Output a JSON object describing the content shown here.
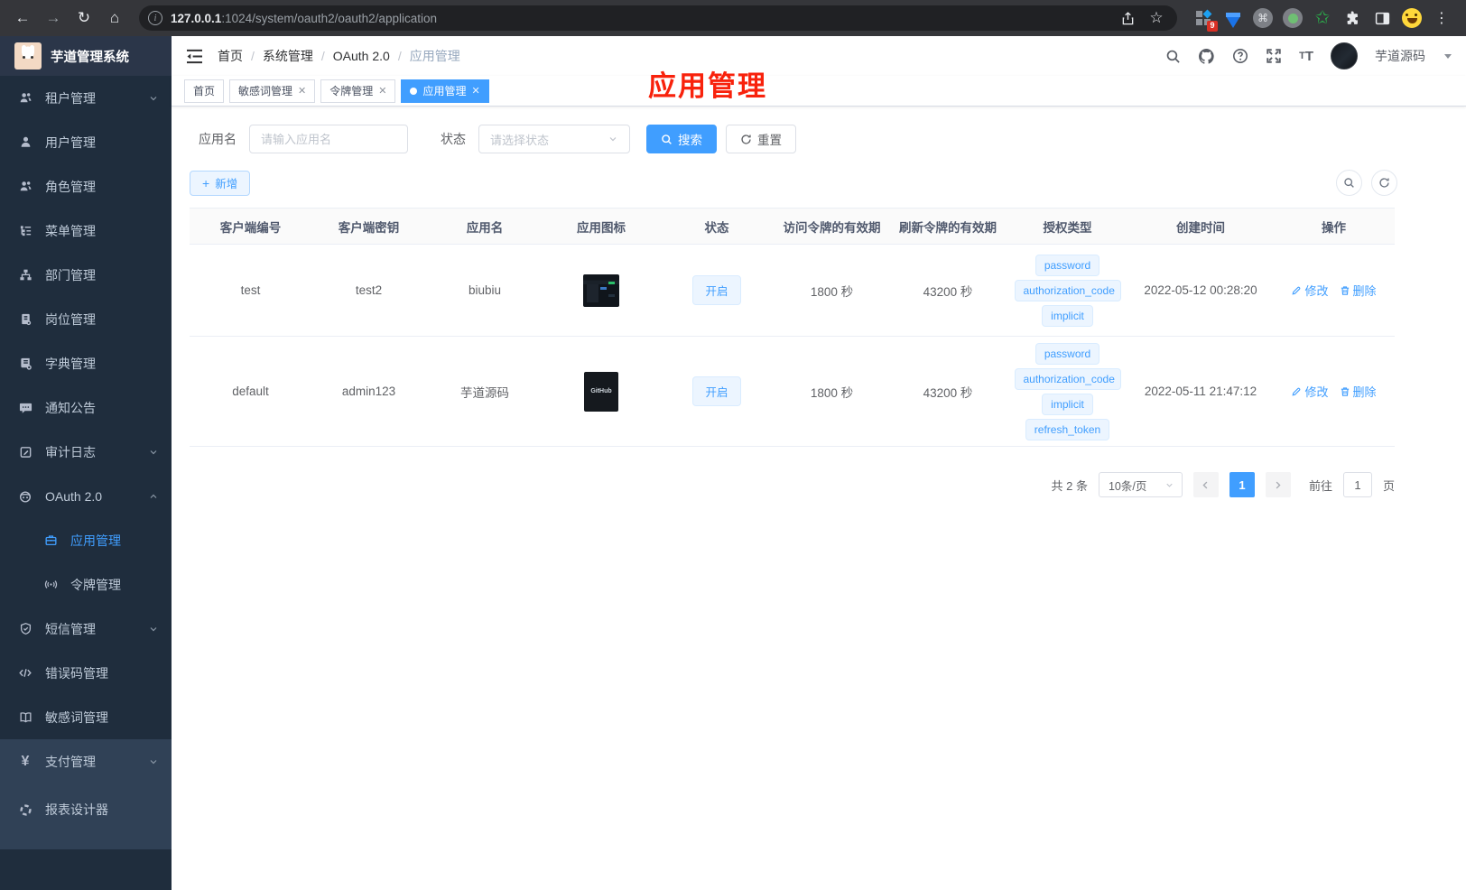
{
  "browser": {
    "url_host": "127.0.0.1",
    "url_path": ":1024/system/oauth2/oauth2/application",
    "extension_badge": "9"
  },
  "sidebar": {
    "title": "芋道管理系统",
    "items": [
      {
        "label": "租户管理",
        "icon": "tenants-icon"
      },
      {
        "label": "用户管理",
        "icon": "user-icon"
      },
      {
        "label": "角色管理",
        "icon": "roles-icon"
      },
      {
        "label": "菜单管理",
        "icon": "menu-tree-icon"
      },
      {
        "label": "部门管理",
        "icon": "dept-icon"
      },
      {
        "label": "岗位管理",
        "icon": "post-icon"
      },
      {
        "label": "字典管理",
        "icon": "dict-icon"
      },
      {
        "label": "通知公告",
        "icon": "notice-icon"
      },
      {
        "label": "审计日志",
        "icon": "audit-icon"
      },
      {
        "label": "OAuth 2.0",
        "icon": "oauth-robot-icon"
      },
      {
        "label": "应用管理",
        "icon": "briefcase-icon"
      },
      {
        "label": "令牌管理",
        "icon": "token-broadcast-icon"
      },
      {
        "label": "短信管理",
        "icon": "shield-icon"
      },
      {
        "label": "错误码管理",
        "icon": "code-icon"
      },
      {
        "label": "敏感词管理",
        "icon": "open-book-icon"
      },
      {
        "label": "支付管理",
        "icon": "yen-icon"
      },
      {
        "label": "报表设计器",
        "icon": "report-icon"
      }
    ]
  },
  "header": {
    "breadcrumb": [
      "首页",
      "系统管理",
      "OAuth 2.0",
      "应用管理"
    ],
    "user_name": "芋道源码"
  },
  "tabs": [
    {
      "label": "首页"
    },
    {
      "label": "敏感词管理"
    },
    {
      "label": "令牌管理"
    },
    {
      "label": "应用管理"
    }
  ],
  "annotation": {
    "text": "应用管理"
  },
  "filters": {
    "name_label": "应用名",
    "name_placeholder": "请输入应用名",
    "status_label": "状态",
    "status_placeholder": "请选择状态",
    "search_label": "搜索",
    "reset_label": "重置"
  },
  "toolbar": {
    "add_label": "新增"
  },
  "table": {
    "columns": [
      "客户端编号",
      "客户端密钥",
      "应用名",
      "应用图标",
      "状态",
      "访问令牌的有效期",
      "刷新令牌的有效期",
      "授权类型",
      "创建时间",
      "操作"
    ],
    "actions": {
      "edit": "修改",
      "delete": "删除"
    },
    "rows": [
      {
        "client_id": "test",
        "client_secret": "test2",
        "app_name": "biubiu",
        "app_icon": "dark-dashboard-screenshot",
        "status": "开启",
        "access_token_ttl": "1800 秒",
        "refresh_token_ttl": "43200 秒",
        "grant_types": [
          "password",
          "authorization_code",
          "implicit"
        ],
        "created_at": "2022-05-12 00:28:20"
      },
      {
        "client_id": "default",
        "client_secret": "admin123",
        "app_name": "芋道源码",
        "app_icon": "github-dark",
        "app_icon_caption": "GitHub",
        "status": "开启",
        "access_token_ttl": "1800 秒",
        "refresh_token_ttl": "43200 秒",
        "grant_types": [
          "password",
          "authorization_code",
          "implicit",
          "refresh_token"
        ],
        "created_at": "2022-05-11 21:47:12"
      }
    ]
  },
  "pagination": {
    "total": "共 2 条",
    "page_size": "10条/页",
    "current_page": "1",
    "goto_label": "前往",
    "goto_value": "1",
    "goto_unit": "页"
  },
  "colors": {
    "accent": "#409eff",
    "tag_bg": "#ecf5ff",
    "tag_border": "#d9ecff",
    "sidebar_bg": "#304156",
    "sidebar_nested_bg": "#1f2d3d",
    "annotation_red": "#f8220c",
    "status_text": "#409eff"
  }
}
